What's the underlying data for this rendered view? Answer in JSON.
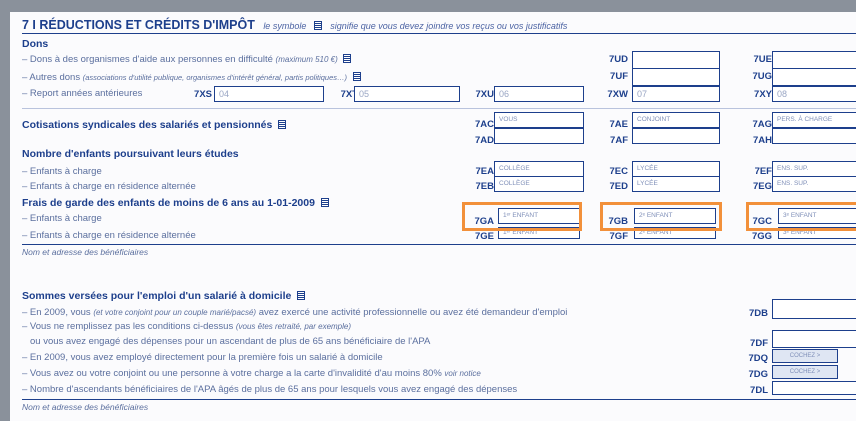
{
  "section": {
    "title": "7 I RÉDUCTIONS ET CRÉDITS D'IMPÔT",
    "subtitle_a": "le symbole",
    "subtitle_b": "signifie que vous devez joindre vos reçus ou vos justificatifs"
  },
  "dons": {
    "heading": "Dons",
    "line1": "– Dons à des organismes d'aide aux personnes en difficulté",
    "line1_note": "(maximum 510 €)",
    "line2": "– Autres dons",
    "line2_note": "(associations d'utilité publique, organismes d'intérêt général, partis politiques…)",
    "line3": "– Report années antérieures",
    "codes": {
      "ud": "7UD",
      "ue": "7UE",
      "uf": "7UF",
      "ug": "7UG",
      "xs": "7XS",
      "xt": "7XT",
      "xu": "7XU",
      "xw": "7XW",
      "xy": "7XY"
    },
    "values": {
      "xs": "04",
      "xt": "05",
      "xu": "06",
      "xw": "07",
      "xy": "08"
    }
  },
  "cotisations": {
    "heading": "Cotisations syndicales des salariés et pensionnés",
    "codes": {
      "ac": "7AC",
      "ae": "7AE",
      "ag": "7AG",
      "ad": "7AD",
      "af": "7AF",
      "ah": "7AH"
    },
    "tags": {
      "vous": "VOUS",
      "conjoint": "CONJOINT",
      "pers": "PERS. À CHARGE"
    }
  },
  "etudes": {
    "heading": "Nombre d'enfants poursuivant leurs études",
    "line1": "– Enfants à charge",
    "line2": "– Enfants à charge en résidence alternée",
    "codes": {
      "ea": "7EA",
      "ec": "7EC",
      "ef": "7EF",
      "eb": "7EB",
      "ed": "7ED",
      "eg": "7EG"
    },
    "tags": {
      "college": "COLLÈGE",
      "lycee": "LYCÉE",
      "sup": "ENS. SUP."
    }
  },
  "garde": {
    "heading": "Frais de garde des enfants de moins de 6 ans au 1-01-2009",
    "line1": "– Enfants à charge",
    "line2": "– Enfants à charge en résidence alternée",
    "codes": {
      "ga": "7GA",
      "gb": "7GB",
      "gc": "7GC",
      "ge": "7GE",
      "gf": "7GF",
      "gg": "7GG"
    },
    "tags": {
      "e1": "1ᵉʳ ENFANT",
      "e2": "2ᵉ ENFANT",
      "e3": "3ᵉ ENFANT"
    },
    "beneficiaries_label": "Nom et adresse des bénéficiaires"
  },
  "domicile": {
    "heading": "Sommes versées pour l'emploi d'un salarié à domicile",
    "line1_a": "– En 2009, vous",
    "line1_note": "(et votre conjoint pour un couple marié/pacsé)",
    "line1_b": "avez exercé une activité professionnelle ou avez été demandeur d'emploi",
    "line2_a": "– Vous ne remplissez pas les conditions ci-dessus",
    "line2_note": "(vous êtes retraité, par exemple)",
    "line3": "ou vous avez engagé des dépenses pour un ascendant de plus de 65 ans bénéficiaire de l'APA",
    "line4": "– En 2009, vous avez employé directement pour la première fois un salarié à domicile",
    "line5_a": "– Vous avez ou votre conjoint ou une personne à votre charge a la carte d'invalidité d'au moins 80%",
    "line5_note": "voir notice",
    "line6": "– Nombre d'ascendants bénéficiaires de l'APA âgés de plus de 65 ans pour lesquels vous avez engagé des dépenses",
    "codes": {
      "db": "7DB",
      "df": "7DF",
      "dq": "7DQ",
      "dg": "7DG",
      "dl": "7DL"
    },
    "tags": {
      "cochez": "COCHEZ >"
    },
    "beneficiaries_label": "Nom et adresse des bénéficiaires"
  },
  "colors": {
    "ink": "#1d3f8c",
    "highlight": "#f2903a",
    "background": "#8a919b"
  }
}
